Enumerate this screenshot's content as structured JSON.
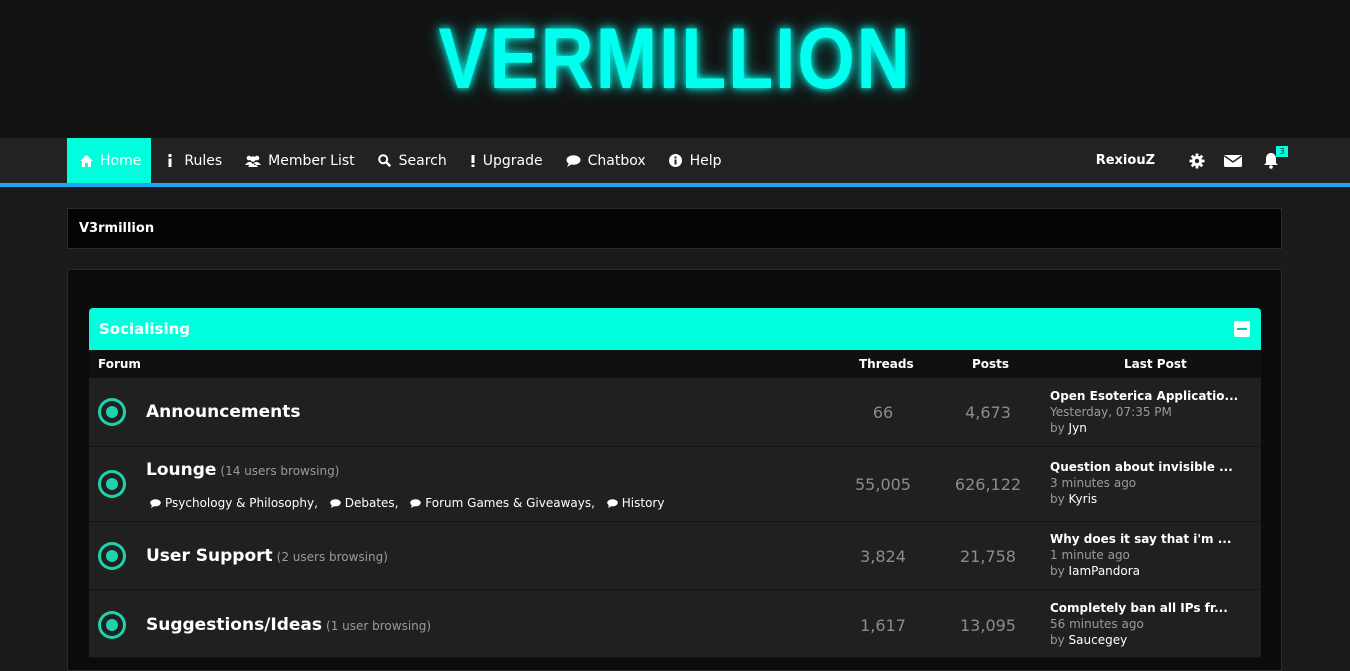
{
  "site": {
    "logo_text": "VERMILLION"
  },
  "nav": {
    "items": [
      {
        "label": "Home",
        "icon": "home-icon"
      },
      {
        "label": "Rules",
        "icon": "info-icon"
      },
      {
        "label": "Member List",
        "icon": "users-icon"
      },
      {
        "label": "Search",
        "icon": "search-icon"
      },
      {
        "label": "Upgrade",
        "icon": "exclamation-icon"
      },
      {
        "label": "Chatbox",
        "icon": "chat-bubble-icon"
      },
      {
        "label": "Help",
        "icon": "info-circle-icon"
      }
    ],
    "username": "RexiouZ",
    "notification_count": "3"
  },
  "breadcrumb": {
    "label": "V3rmillion"
  },
  "category": {
    "title": "Socialising",
    "columns": {
      "forum": "Forum",
      "threads": "Threads",
      "posts": "Posts",
      "last_post": "Last Post"
    },
    "forums": [
      {
        "name": "Announcements",
        "browsing": "",
        "threads": "66",
        "posts": "4,673",
        "last_post": {
          "title": "Open Esoterica Applicatio...",
          "time": "Yesterday, 07:35 PM",
          "by_prefix": "by",
          "user": "Jyn"
        },
        "subforums": []
      },
      {
        "name": "Lounge",
        "browsing": "(14 users browsing)",
        "threads": "55,005",
        "posts": "626,122",
        "last_post": {
          "title": "Question about invisible ...",
          "time": "3 minutes ago",
          "by_prefix": "by",
          "user": "Kyris"
        },
        "subforums": [
          "Psychology & Philosophy,",
          "Debates,",
          "Forum Games & Giveaways,",
          "History"
        ]
      },
      {
        "name": "User Support",
        "browsing": "(2 users browsing)",
        "threads": "3,824",
        "posts": "21,758",
        "last_post": {
          "title": "Why does it say that i'm ...",
          "time": "1 minute ago",
          "by_prefix": "by",
          "user": "IamPandora"
        },
        "subforums": []
      },
      {
        "name": "Suggestions/Ideas",
        "browsing": "(1 user browsing)",
        "threads": "1,617",
        "posts": "13,095",
        "last_post": {
          "title": "Completely ban all IPs fr...",
          "time": "56 minutes ago",
          "by_prefix": "by",
          "user": "Saucegey"
        },
        "subforums": []
      }
    ]
  },
  "colors": {
    "accent": "#00ffdd",
    "nav_line": "#1ea7f0",
    "status": "#1fd1ad"
  }
}
